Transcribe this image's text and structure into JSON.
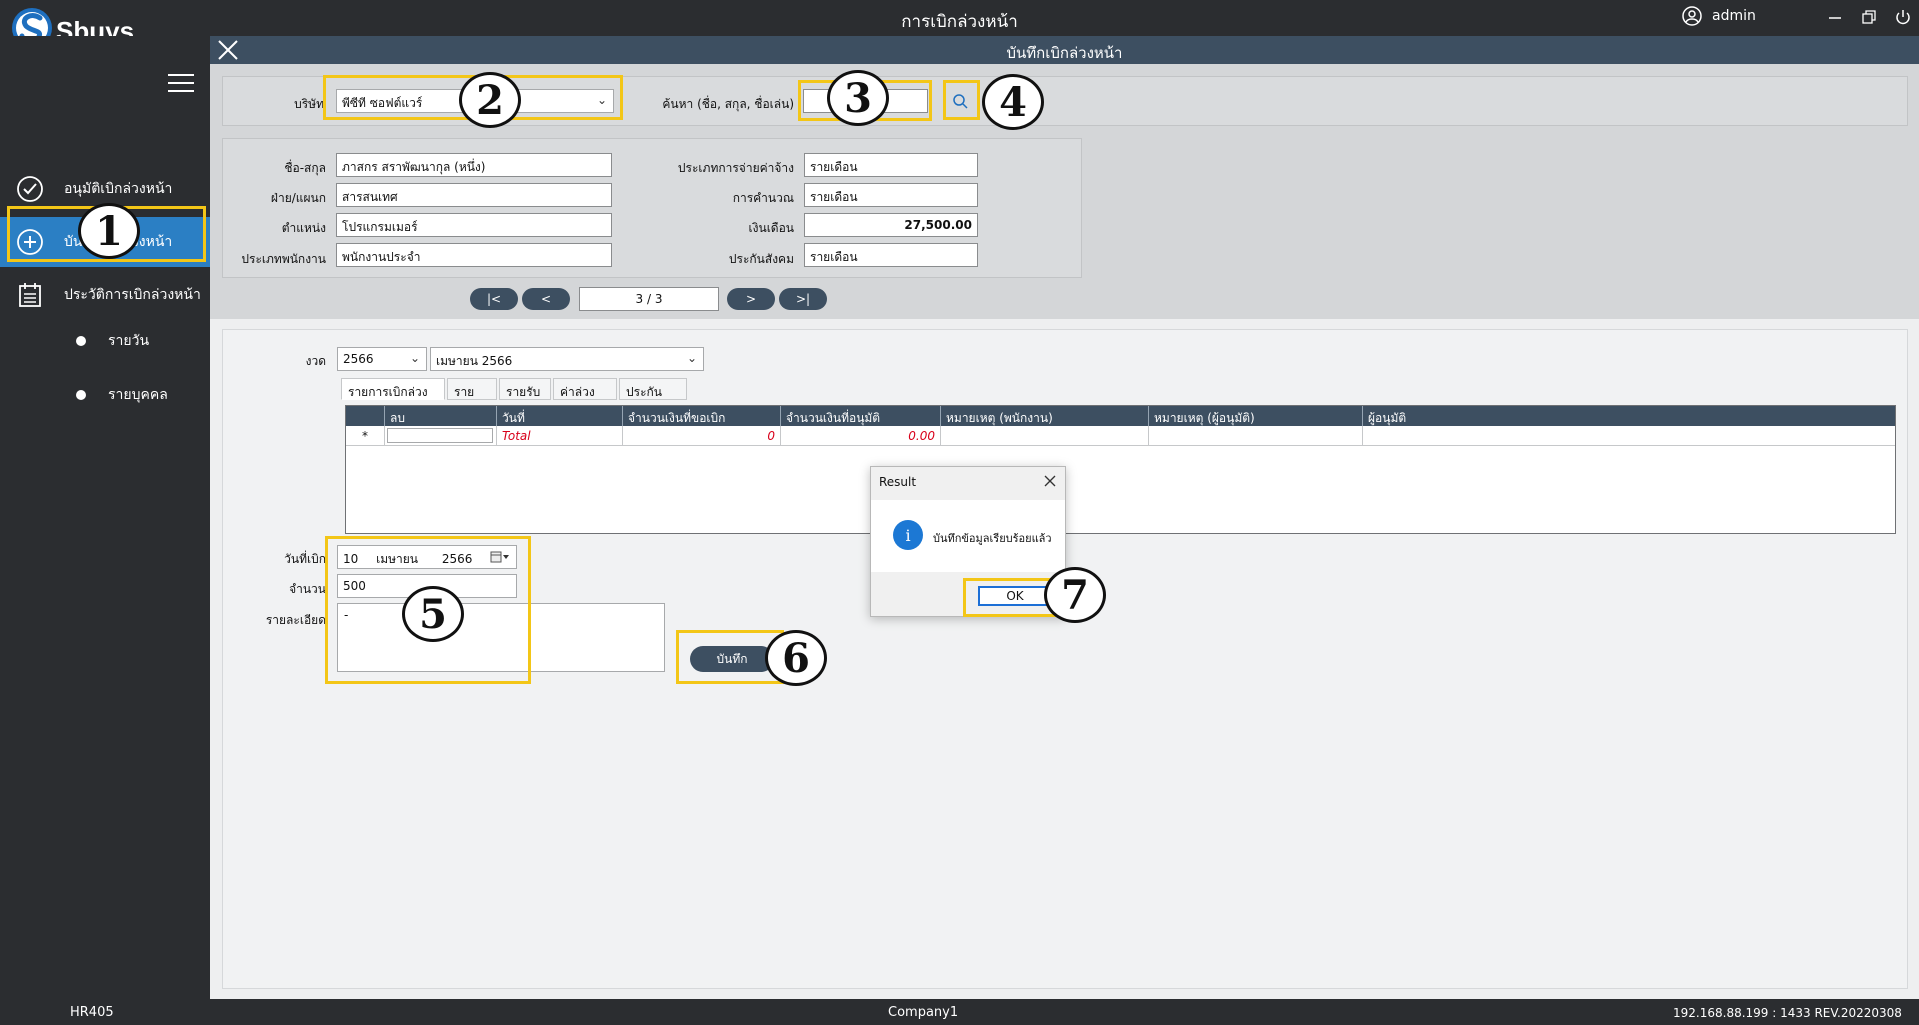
{
  "app": {
    "title": "การเบิกล่วงหน้า",
    "user": "admin"
  },
  "sidebar": {
    "items": [
      {
        "label": "อนุมัติเบิกล่วงหน้า"
      },
      {
        "label": "บันทึกเบิกล่วงหน้า"
      },
      {
        "label": "ประวัติการเบิกล่วงหน้า"
      }
    ],
    "subitems": [
      {
        "label": "รายวัน"
      },
      {
        "label": "รายบุคคล"
      }
    ]
  },
  "panel": {
    "title": "บันทึกเบิกล่วงหน้า"
  },
  "search": {
    "company_label": "บริษัท",
    "company_value": "พีซีที ซอฟต์แวร์",
    "search_label": "ค้นหา (ชื่อ, สกุล, ชื่อเล่น)",
    "search_value": ""
  },
  "employee": {
    "name_label": "ชื่อ-สกุล",
    "name_value": "ภาสกร สราพัฒนากุล (หนึ่ง)",
    "dept_label": "ฝ่าย/แผนก",
    "dept_value": "สารสนเทศ",
    "position_label": "ตำแหน่ง",
    "position_value": "โปรแกรมเมอร์",
    "type_label": "ประเภทพนักงาน",
    "type_value": "พนักงานประจำ",
    "paytype_label": "ประเภทการจ่ายค่าจ้าง",
    "paytype_value": "รายเดือน",
    "calc_label": "การคำนวณ",
    "calc_value": "รายเดือน",
    "salary_label": "เงินเดือน",
    "salary_value": "27,500.00",
    "ss_label": "ประกันสังคม",
    "ss_value": "รายเดือน"
  },
  "pager": {
    "first": "|<",
    "prev": "<",
    "indicator": "3 / 3",
    "next": ">",
    "last": ">|"
  },
  "period": {
    "label": "งวด",
    "year": "2566",
    "month": "เมษายน 2566"
  },
  "tabs": [
    {
      "label": "รายการเบิกล่วงหน้า"
    },
    {
      "label": "รายจ่าย"
    },
    {
      "label": "รายรับ"
    },
    {
      "label": "ค่าล่วงเวลา"
    },
    {
      "label": "ประกันสังคม"
    }
  ],
  "grid": {
    "columns": [
      "ลบ",
      "วันที่",
      "จำนวนเงินที่ขอเบิก",
      "จำนวนเงินที่อนุมัติ",
      "หมายเหตุ (พนักงาน)",
      "หมายเหตุ (ผู้อนุมัติ)",
      "ผู้อนุมัติ"
    ],
    "row_marker": "*",
    "total_label": "Total",
    "total_request": "0",
    "total_approved": "0.00"
  },
  "form": {
    "date_label": "วันที่เบิก",
    "date_day": "10",
    "date_month": "เมษายน",
    "date_year": "2566",
    "amount_label": "จำนวน",
    "amount_value": "500",
    "detail_label": "รายละเอียด",
    "detail_value": "-",
    "save_label": "บันทึก"
  },
  "dialog": {
    "title": "Result",
    "message": "บันทึกข้อมูลเรียบร้อยแล้ว",
    "ok": "OK",
    "icon": "i"
  },
  "callouts": [
    "1",
    "2",
    "3",
    "4",
    "5",
    "6",
    "7"
  ],
  "status": {
    "left": "HR405",
    "center": "Company1",
    "right": "192.168.88.199 : 1433  REV.20220308"
  },
  "colors": {
    "accent": "#f3c617",
    "active_nav": "#2b7fc4",
    "header": "#3d4f61"
  }
}
